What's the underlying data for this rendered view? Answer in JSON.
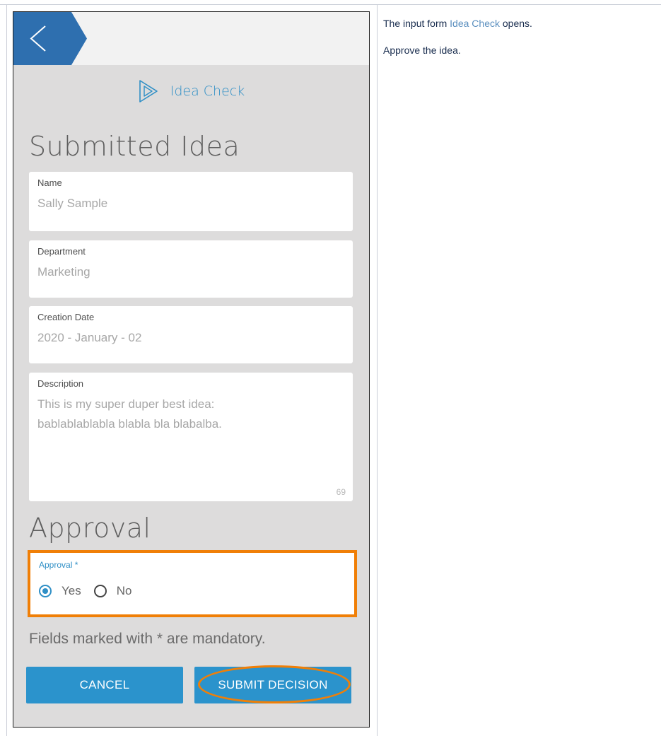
{
  "form": {
    "brand_label": "Idea Check",
    "submitted_section_title": "Submitted Idea",
    "fields": [
      {
        "label": "Name",
        "value": "Sally Sample"
      },
      {
        "label": "Department",
        "value": "Marketing"
      },
      {
        "label": "Creation Date",
        "value": "2020 - January - 02"
      },
      {
        "label": "Description",
        "value": "This is my super duper best idea:\nbablablablabla blabla bla blabalba.",
        "char_count": "69"
      }
    ],
    "approval_section_title": "Approval",
    "approval_field": {
      "label": "Approval *",
      "options": [
        {
          "label": "Yes",
          "selected": true
        },
        {
          "label": "No",
          "selected": false
        }
      ]
    },
    "mandatory_note": "Fields marked with * are mandatory.",
    "cancel_label": "CANCEL",
    "submit_label": "SUBMIT DECISION"
  },
  "instructions": {
    "line1_prefix": "The input form ",
    "line1_link": "Idea Check",
    "line1_suffix": " opens.",
    "line2": "Approve the idea."
  },
  "colors": {
    "accent": "#2b93cc",
    "highlight": "#f07f07",
    "back_button": "#2e6faf"
  },
  "icons": [
    "back-chevron-icon",
    "play-triangle-icon",
    "radio-checked-icon",
    "radio-unchecked-icon"
  ]
}
